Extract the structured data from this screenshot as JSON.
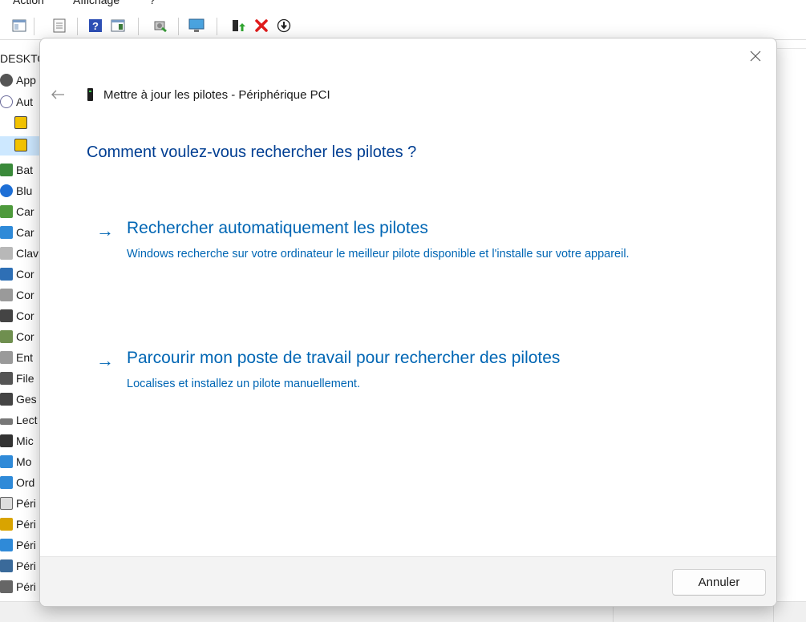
{
  "background_window": {
    "menu": [
      "Action",
      "Affichage",
      "?"
    ],
    "computer_label": "DESKTO",
    "tree_items": [
      "App",
      "Aut",
      "",
      "",
      "Bat",
      "Blu",
      "Car",
      "Car",
      "Clav",
      "Cor",
      "Cor",
      "Cor",
      "Cor",
      "Ent",
      "File",
      "Ges",
      "Lect",
      "Mic",
      "Mo",
      "Ord",
      "Péri",
      "Péri",
      "Péri",
      "Péri",
      "Péri"
    ]
  },
  "dialog": {
    "title": "Mettre à jour les pilotes - Périphérique PCI",
    "question": "Comment voulez-vous rechercher les pilotes ?",
    "options": [
      {
        "arrow": "→",
        "title": "Rechercher automatiquement les pilotes",
        "description": "Windows recherche sur votre ordinateur le meilleur pilote disponible et l'installe sur votre appareil."
      },
      {
        "arrow": "→",
        "title": "Parcourir mon poste de travail pour rechercher des pilotes",
        "description": "Localises et installez un pilote manuellement."
      }
    ],
    "cancel_label": "Annuler",
    "close_glyph": "✕",
    "back_glyph": "←"
  },
  "colors": {
    "link_blue": "#0066b4",
    "heading_blue": "#003e92",
    "footer_bg": "#f3f3f3"
  }
}
